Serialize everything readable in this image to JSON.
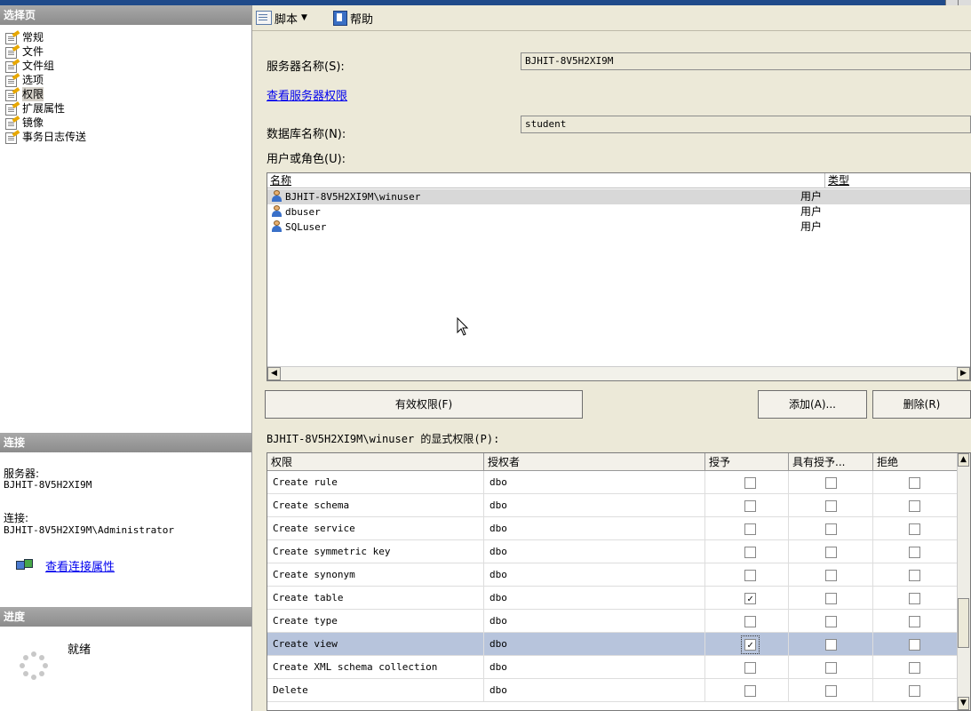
{
  "left": {
    "select_page_header": "选择页",
    "pages": [
      {
        "label": "常规",
        "selected": false
      },
      {
        "label": "文件",
        "selected": false
      },
      {
        "label": "文件组",
        "selected": false
      },
      {
        "label": "选项",
        "selected": false
      },
      {
        "label": "权限",
        "selected": true
      },
      {
        "label": "扩展属性",
        "selected": false
      },
      {
        "label": "镜像",
        "selected": false
      },
      {
        "label": "事务日志传送",
        "selected": false
      }
    ],
    "connection_header": "连接",
    "server_label": "服务器:",
    "server_value": "BJHIT-8V5H2XI9M",
    "connection_label": "连接:",
    "connection_value": "BJHIT-8V5H2XI9M\\Administrator",
    "view_connection_link": "查看连接属性",
    "progress_header": "进度",
    "progress_status": "就绪"
  },
  "toolbar": {
    "script_label": "脚本",
    "help_label": "帮助"
  },
  "main": {
    "server_name_label": "服务器名称(S):",
    "server_name_value": "BJHIT-8V5H2XI9M",
    "view_server_permissions_link": "查看服务器权限",
    "database_name_label": "数据库名称(N):",
    "database_name_value": "student",
    "users_roles_label": "用户或角色(U):",
    "users_columns": [
      "名称",
      "类型"
    ],
    "users": [
      {
        "name": "BJHIT-8V5H2XI9M\\winuser",
        "type": "用户",
        "selected": true
      },
      {
        "name": "dbuser",
        "type": "用户",
        "selected": false
      },
      {
        "name": "SQLuser",
        "type": "用户",
        "selected": false
      }
    ],
    "effective_permissions_button": "有效权限(F)",
    "add_button": "添加(A)...",
    "remove_button": "删除(R)",
    "explicit_permissions_label": "BJHIT-8V5H2XI9M\\winuser 的显式权限(P):",
    "permissions_columns": [
      "权限",
      "授权者",
      "授予",
      "具有授予...",
      "拒绝"
    ],
    "permissions": [
      {
        "permission": "Create rule",
        "grantor": "dbo",
        "grant": false,
        "with_grant": false,
        "deny": false,
        "selected": false
      },
      {
        "permission": "Create schema",
        "grantor": "dbo",
        "grant": false,
        "with_grant": false,
        "deny": false,
        "selected": false
      },
      {
        "permission": "Create service",
        "grantor": "dbo",
        "grant": false,
        "with_grant": false,
        "deny": false,
        "selected": false
      },
      {
        "permission": "Create symmetric key",
        "grantor": "dbo",
        "grant": false,
        "with_grant": false,
        "deny": false,
        "selected": false
      },
      {
        "permission": "Create synonym",
        "grantor": "dbo",
        "grant": false,
        "with_grant": false,
        "deny": false,
        "selected": false
      },
      {
        "permission": "Create table",
        "grantor": "dbo",
        "grant": true,
        "with_grant": false,
        "deny": false,
        "selected": false
      },
      {
        "permission": "Create type",
        "grantor": "dbo",
        "grant": false,
        "with_grant": false,
        "deny": false,
        "selected": false
      },
      {
        "permission": "Create view",
        "grantor": "dbo",
        "grant": true,
        "with_grant": false,
        "deny": false,
        "selected": true
      },
      {
        "permission": "Create XML schema collection",
        "grantor": "dbo",
        "grant": false,
        "with_grant": false,
        "deny": false,
        "selected": false
      },
      {
        "permission": "Delete",
        "grantor": "dbo",
        "grant": false,
        "with_grant": false,
        "deny": false,
        "selected": false
      }
    ]
  }
}
